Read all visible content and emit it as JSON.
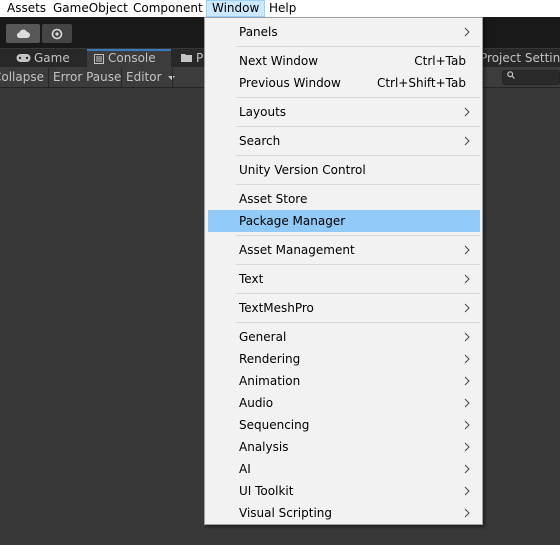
{
  "menubar": {
    "items": [
      "Assets",
      "GameObject",
      "Component",
      "Window",
      "Help"
    ]
  },
  "tabs": {
    "game": "Game",
    "console": "Console",
    "project_partial": "P",
    "project_settings": "Project Setting"
  },
  "console_toolbar": {
    "collapse": "Collapse",
    "error_pause": "Error Pause",
    "editor": "Editor"
  },
  "menu": {
    "panels": "Panels",
    "next_window": "Next Window",
    "next_window_shortcut": "Ctrl+Tab",
    "previous_window": "Previous Window",
    "previous_window_shortcut": "Ctrl+Shift+Tab",
    "layouts": "Layouts",
    "search": "Search",
    "unity_version_control": "Unity Version Control",
    "asset_store": "Asset Store",
    "package_manager": "Package Manager",
    "asset_management": "Asset Management",
    "text": "Text",
    "textmeshpro": "TextMeshPro",
    "general": "General",
    "rendering": "Rendering",
    "animation": "Animation",
    "audio": "Audio",
    "sequencing": "Sequencing",
    "analysis": "Analysis",
    "ai": "AI",
    "ui_toolkit": "UI Toolkit",
    "visual_scripting": "Visual Scripting"
  },
  "highlighted_item": "Package Manager",
  "colors": {
    "highlight": "#91c9f7",
    "menubar_active": "#cce8ff",
    "editor_bg": "#383838"
  }
}
